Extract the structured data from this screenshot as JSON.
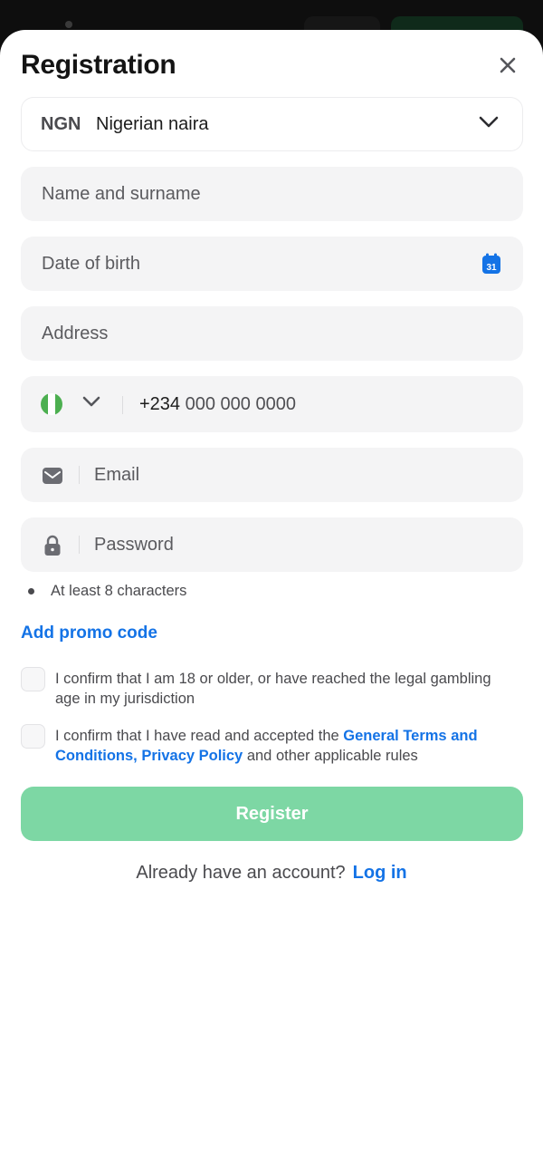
{
  "modal": {
    "title": "Registration",
    "close_icon": "close-icon"
  },
  "currency": {
    "code": "NGN",
    "name": "Nigerian naira",
    "icon": "chevron-down-icon"
  },
  "fields": {
    "name_placeholder": "Name and surname",
    "dob_placeholder": "Date of birth",
    "dob_icon": "calendar-icon",
    "calendar_day": "31",
    "address_placeholder": "Address",
    "email_placeholder": "Email",
    "email_icon": "mail-icon",
    "password_placeholder": "Password",
    "password_icon": "lock-icon"
  },
  "phone": {
    "country_flag": "nigeria-flag-icon",
    "prefix": "+234",
    "number_placeholder": "000 000 0000"
  },
  "password_hint": "At least 8 characters",
  "promo_label": "Add promo code",
  "consents": {
    "age_text": "I confirm that I am 18 or older, or have reached the legal gambling age in my jurisdiction",
    "terms_prefix": "I confirm that I have read and accepted the ",
    "terms_link": "General Terms and Conditions",
    "terms_comma": ", ",
    "privacy_link": "Privacy Policy",
    "terms_suffix": " and other applicable rules"
  },
  "register_label": "Register",
  "login": {
    "prompt": "Already have an account?",
    "link": "Log in"
  },
  "colors": {
    "accent": "#1473e6",
    "register_disabled": "#7dd7a4",
    "field_bg": "#f4f4f5",
    "flag_green": "#4caf50"
  }
}
